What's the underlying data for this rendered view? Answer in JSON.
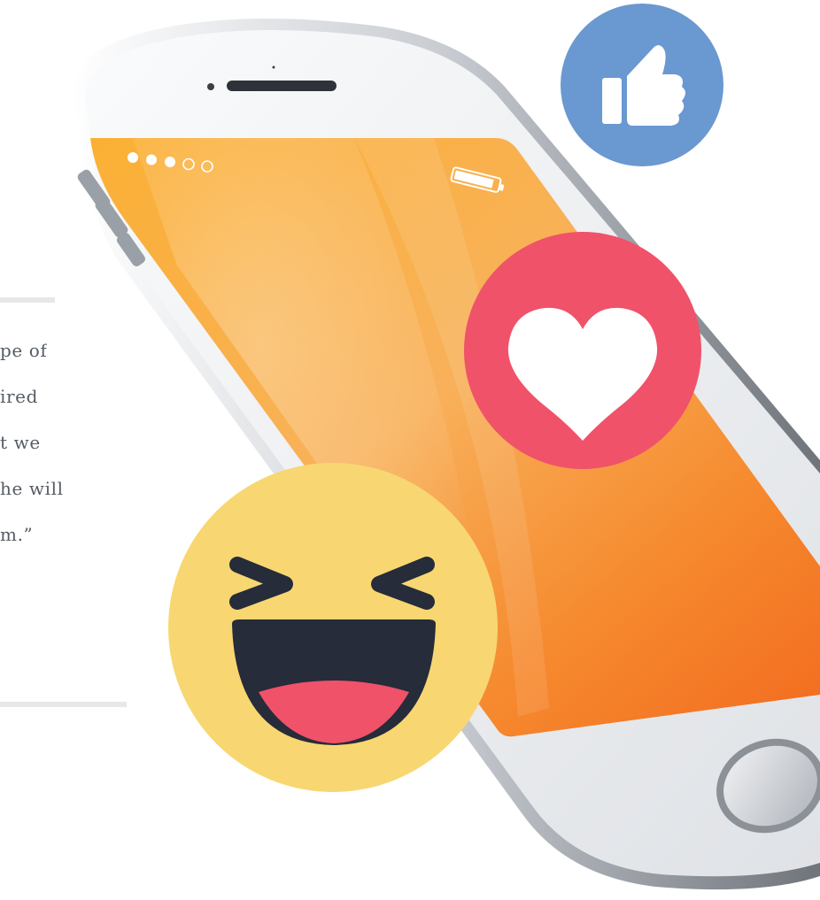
{
  "quote": {
    "lines": [
      "pe of",
      "ired",
      "t we",
      "he will",
      "m.”"
    ]
  },
  "phone": {
    "signal_dots_filled": 3,
    "signal_dots_total": 5,
    "battery_level": 0.9
  },
  "reactions": [
    {
      "name": "like",
      "icon": "thumbs-up-icon",
      "color": "#6a98d0"
    },
    {
      "name": "love",
      "icon": "heart-icon",
      "color": "#f0526a"
    },
    {
      "name": "haha",
      "icon": "laughing-face-icon",
      "color": "#f8d772"
    }
  ],
  "colors": {
    "screen_top": "#fbb034",
    "screen_bottom": "#f26b1f",
    "phone_body": "#f4f5f7",
    "rule": "#e7e7e7",
    "quote_text": "#555c64"
  }
}
